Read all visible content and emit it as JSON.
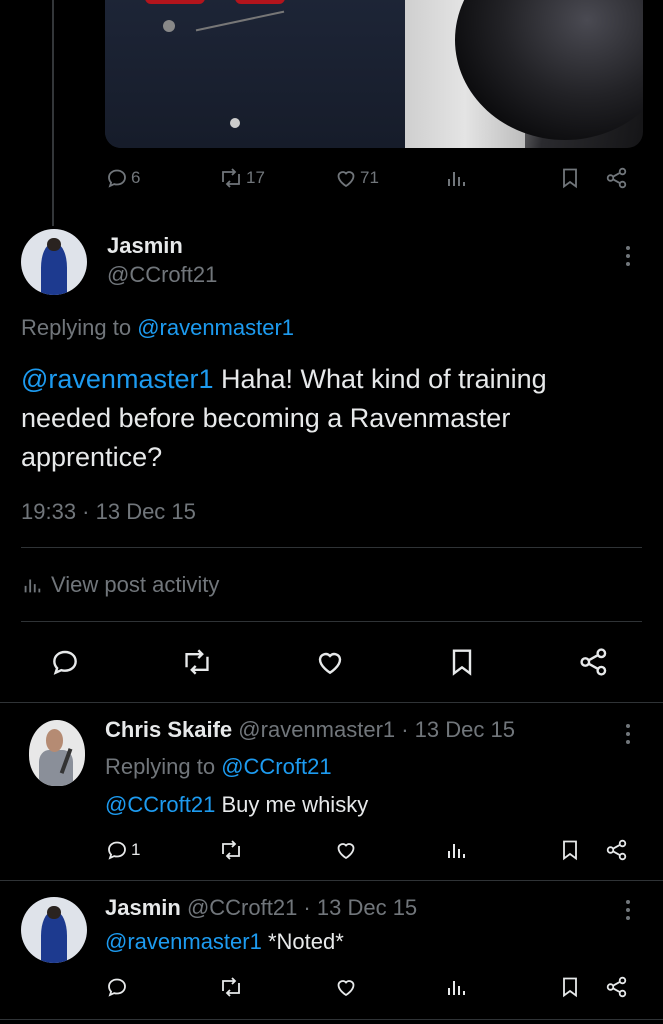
{
  "top_tweet": {
    "actions": {
      "reply_count": "6",
      "retweet_count": "17",
      "like_count": "71"
    }
  },
  "main_tweet": {
    "author_name": "Jasmin",
    "author_handle": "@CCroft21",
    "replying_to_prefix": "Replying to ",
    "replying_to_handle": "@ravenmaster1",
    "mention": "@ravenmaster1",
    "text": " Haha! What kind of training needed before becoming a Ravenmaster apprentice?",
    "timestamp": "19:33 · 13 Dec 15",
    "view_activity_label": "View post activity"
  },
  "replies": [
    {
      "author_name": "Chris Skaife",
      "meta": "@ravenmaster1 · 13 Dec 15",
      "replying_to_prefix": "Replying to ",
      "replying_to_handle": "@CCroft21",
      "mention": "@CCroft21",
      "text": " Buy me whisky",
      "reply_count": "1"
    },
    {
      "author_name": "Jasmin",
      "meta": "@CCroft21 · 13 Dec 15",
      "mention": "@ravenmaster1",
      "text": " *Noted*"
    }
  ],
  "colors": {
    "background": "#000000",
    "text": "#e7e9ea",
    "muted": "#71767b",
    "link": "#1d9bf0",
    "divider": "#2f3336"
  }
}
